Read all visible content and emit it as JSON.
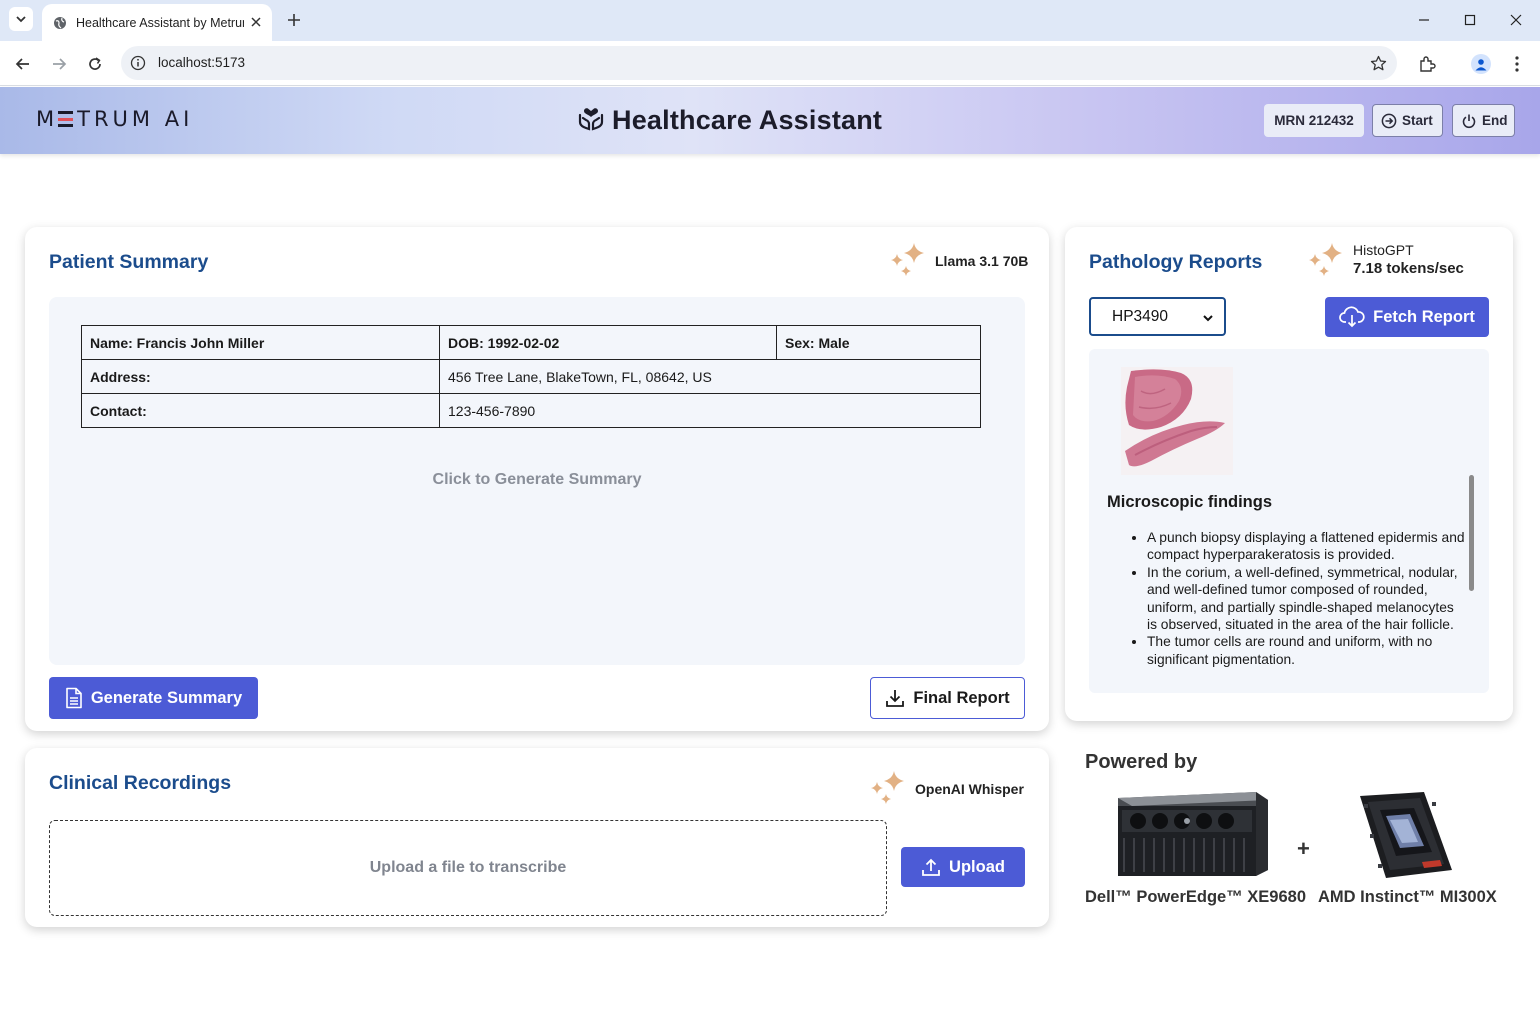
{
  "browser": {
    "tab_title": "Healthcare Assistant by Metrum",
    "url": "localhost:5173"
  },
  "header": {
    "logo_text": "METRUM AI",
    "title": "Healthcare Assistant",
    "mrn": "MRN 212432",
    "start_label": "Start",
    "end_label": "End"
  },
  "patient_summary": {
    "title": "Patient Summary",
    "model": "Llama 3.1 70B",
    "table": {
      "name": "Name: Francis John Miller",
      "dob": "DOB: 1992-02-02",
      "sex": "Sex: Male",
      "address_label": "Address:",
      "address_value": "456 Tree Lane, BlakeTown, FL, 08642, US",
      "contact_label": "Contact:",
      "contact_value": "123-456-7890"
    },
    "placeholder": "Click to Generate Summary",
    "generate_label": "Generate Summary",
    "final_report_label": "Final Report"
  },
  "pathology": {
    "title": "Pathology Reports",
    "model": "HistoGPT",
    "speed": "7.18 tokens/sec",
    "selected_report": "HP3490",
    "fetch_label": "Fetch Report",
    "findings_title": "Microscopic findings",
    "findings": [
      "A punch biopsy displaying a flattened epidermis and compact hyperparakeratosis is provided.",
      "In the corium, a well-defined, symmetrical, nodular, and well-defined tumor composed of rounded, uniform, and partially spindle-shaped melanocytes is observed, situated in the area of the hair follicle.",
      "The tumor cells are round and uniform, with no significant pigmentation."
    ]
  },
  "recordings": {
    "title": "Clinical Recordings",
    "model": "OpenAI Whisper",
    "upload_zone": "Upload a file to transcribe",
    "upload_label": "Upload"
  },
  "powered": {
    "title": "Powered by",
    "plus": "+",
    "server": "Dell™ PowerEdge™ XE9680",
    "gpu": "AMD Instinct™ MI300X"
  },
  "colors": {
    "primary": "#4c5bd6",
    "title_blue": "#1b4c8c",
    "sparkle": "#e2b184"
  }
}
